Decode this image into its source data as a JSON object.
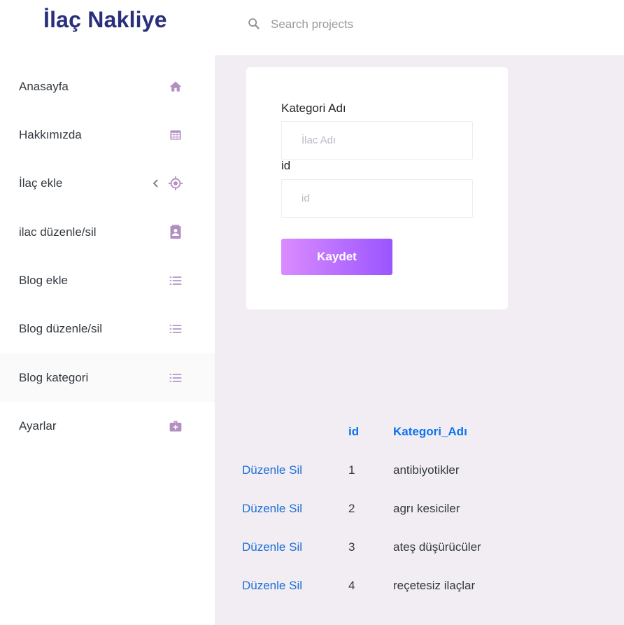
{
  "brand": "İlaç Nakliye",
  "search": {
    "placeholder": "Search projects",
    "icon": "search-icon"
  },
  "sidebar": {
    "items": [
      {
        "label": "Anasayfa",
        "icon": "home-icon"
      },
      {
        "label": "Hakkımızda",
        "icon": "table-icon"
      },
      {
        "label": "İlaç ekle",
        "icon": "crosshair-icon",
        "has_arrow": true
      },
      {
        "label": "ilac düzenle/sil",
        "icon": "contact-card-icon"
      },
      {
        "label": "Blog ekle",
        "icon": "list-icon"
      },
      {
        "label": "Blog düzenle/sil",
        "icon": "list-icon"
      },
      {
        "label": "Blog kategori",
        "icon": "list-icon",
        "active": true
      },
      {
        "label": "Ayarlar",
        "icon": "medical-bag-icon"
      }
    ]
  },
  "form": {
    "category_label": "Kategori Adı",
    "category_placeholder": "İlac Adı",
    "id_label": "id",
    "id_placeholder": "id",
    "save_label": "Kaydet"
  },
  "table": {
    "headers": {
      "id": "id",
      "name": "Kategori_Adı"
    },
    "edit_label": "Düzenle",
    "delete_label": "Sil",
    "rows": [
      {
        "id": "1",
        "name": "antibiyotikler"
      },
      {
        "id": "2",
        "name": "agrı kesiciler"
      },
      {
        "id": "3",
        "name": "ateş düşürücüler"
      },
      {
        "id": "4",
        "name": "reçetesiz ilaçlar"
      }
    ]
  },
  "colors": {
    "brand": "#2a2f7a",
    "icon": "#b28fc2",
    "content_bg": "#f2edf3",
    "button_gradient_start": "#da8cff",
    "button_gradient_end": "#9a55ff",
    "table_header": "#0a73f0",
    "link": "#1b6fd6"
  }
}
